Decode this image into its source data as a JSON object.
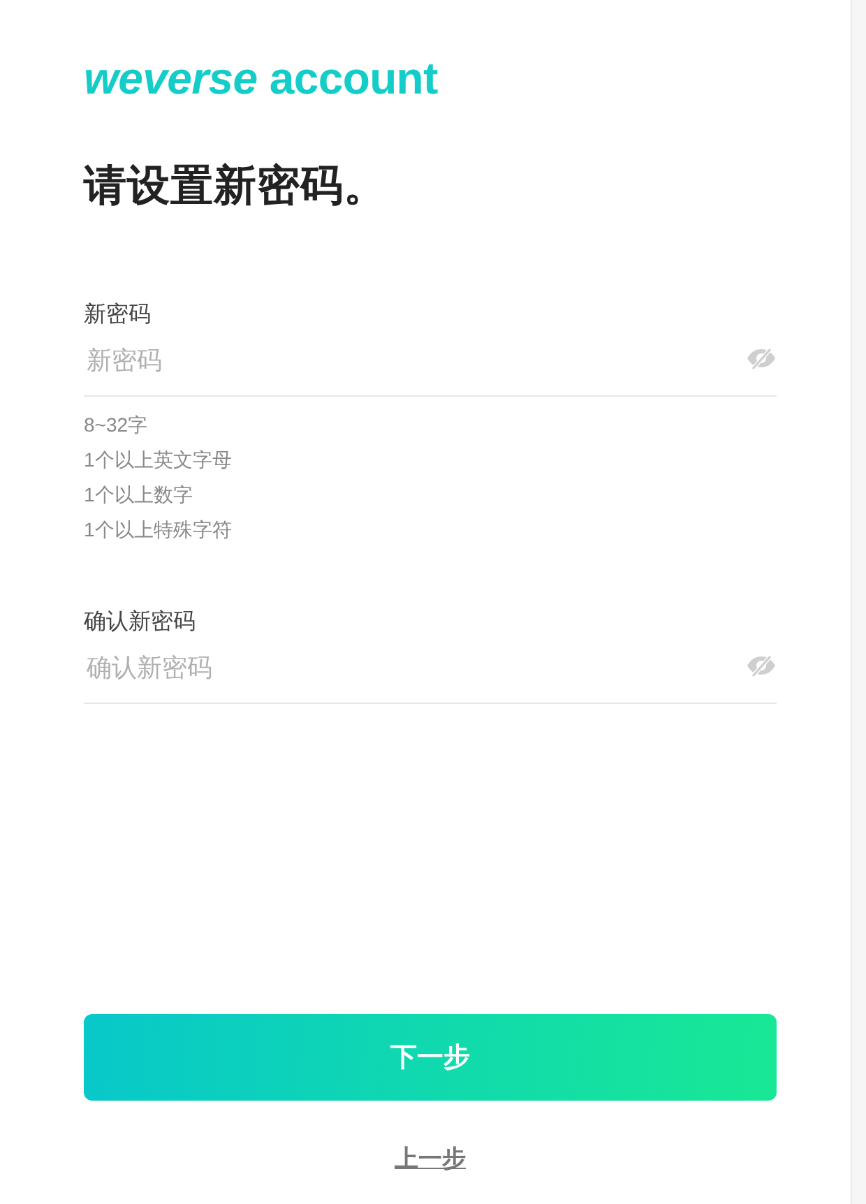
{
  "logo": "*weverse* account",
  "title": "请设置新密码。",
  "fields": [
    {
      "label": "新密码",
      "placeholder": "新密码",
      "hints": [
        "8~32字",
        "1个以上英文字母",
        "1个以上数字",
        "1个以上特殊字符"
      ]
    },
    {
      "label": "确认新密码",
      "placeholder": "确认新密码"
    }
  ],
  "buttons": [
    {
      "kind": "primary",
      "label": "下一步"
    },
    {
      "kind": "link",
      "label": "上一步"
    }
  ]
}
